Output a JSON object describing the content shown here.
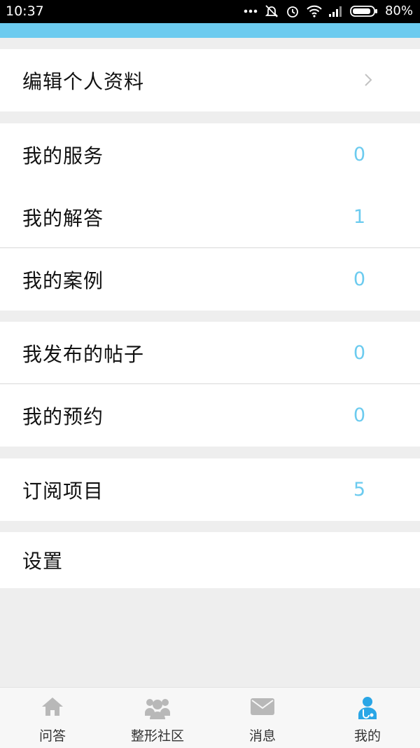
{
  "status_bar": {
    "time": "10:37",
    "battery": "80%"
  },
  "menu_groups": [
    {
      "items": [
        {
          "label": "编辑个人资料",
          "count": ""
        }
      ]
    },
    {
      "items": [
        {
          "label": "我的服务",
          "count": "0"
        },
        {
          "label": "我的解答",
          "count": "1"
        },
        {
          "label": "我的案例",
          "count": "0"
        }
      ]
    },
    {
      "items": [
        {
          "label": "我发布的帖子",
          "count": "0"
        },
        {
          "label": "我的预约",
          "count": "0"
        }
      ]
    },
    {
      "items": [
        {
          "label": "订阅项目",
          "count": "5"
        }
      ]
    },
    {
      "items": [
        {
          "label": "设置",
          "count": ""
        }
      ]
    }
  ],
  "tab_bar": [
    {
      "label": "问答",
      "icon": "home-icon",
      "active": false
    },
    {
      "label": "整形社区",
      "icon": "community-icon",
      "active": false
    },
    {
      "label": "消息",
      "icon": "envelope-icon",
      "active": false
    },
    {
      "label": "我的",
      "icon": "doctor-profile-icon",
      "active": true
    }
  ],
  "colors": {
    "accent": "#6ccbef",
    "inactive_icon": "#b8b8b8",
    "background": "#eeeeee"
  }
}
